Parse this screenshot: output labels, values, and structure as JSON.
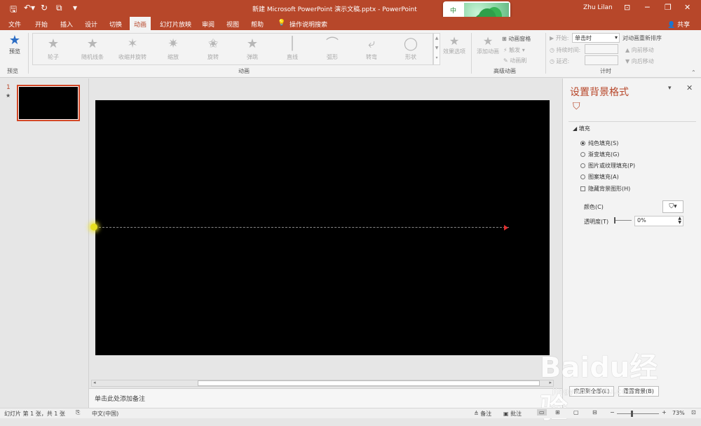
{
  "app": {
    "title": "新建 Microsoft PowerPoint 演示文稿.pptx - PowerPoint",
    "user": "Zhu Lilan",
    "share": "共享",
    "accent": "#b7472a"
  },
  "tabs": [
    "文件",
    "开始",
    "插入",
    "设计",
    "切换",
    "动画",
    "幻灯片放映",
    "审阅",
    "视图",
    "帮助"
  ],
  "active_tab": "动画",
  "tell_me": "操作说明搜索",
  "ribbon": {
    "preview_label": "预览",
    "preview_group": "预览",
    "animations": [
      "轮子",
      "随机线条",
      "收缩并旋转",
      "缩放",
      "旋转",
      "弹跳",
      "直线",
      "弧形",
      "转弯",
      "形状"
    ],
    "effect_options": "效果选项",
    "animations_group": "动画",
    "add_animation": "添加动画",
    "animation_pane": "动画窗格",
    "trigger": "触发",
    "animation_painter": "动画刷",
    "advanced_group": "高级动画",
    "start_label": "开始:",
    "start_value": "单击时",
    "duration_label": "持续时间:",
    "delay_label": "延迟:",
    "timing_group": "计时",
    "reorder_title": "对动画重新排序",
    "move_earlier": "向前移动",
    "move_later": "向后移动"
  },
  "thumbs": {
    "number": "1",
    "star": "★"
  },
  "notes_placeholder": "单击此处添加备注",
  "format_pane": {
    "title": "设置背景格式",
    "section": "填充",
    "options": [
      "纯色填充(S)",
      "渐变填充(G)",
      "图片或纹理填充(P)",
      "图案填充(A)"
    ],
    "selected_option": 0,
    "hide_graphics": "隐藏背景图形(H)",
    "color_label": "颜色(C)",
    "transparency_label": "透明度(T)",
    "transparency_value": "0%",
    "apply_all": "应用到全部(L)",
    "reset": "重置背景(B)"
  },
  "status": {
    "slide_info": "幻灯片 第 1 张，共 1 张",
    "language": "中文(中国)",
    "notes": "备注",
    "comments": "批注",
    "zoom": "73%"
  },
  "popup_chars": [
    "中",
    "°,",
    "⚙"
  ],
  "watermark": {
    "brand": "Baidu经验",
    "url": "jingyan.baidu.com"
  }
}
